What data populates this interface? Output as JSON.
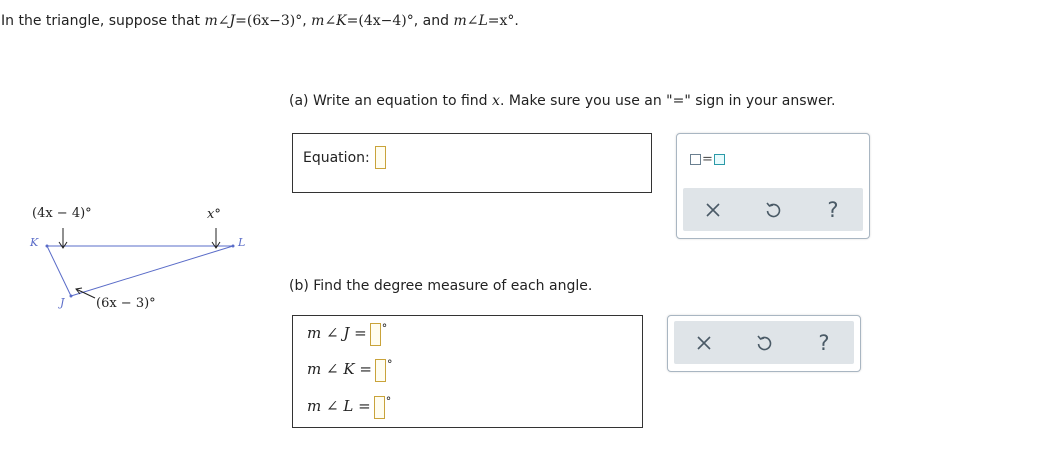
{
  "problem": {
    "intro": "In the triangle, suppose that ",
    "m": "m",
    "angle_symbol": "∠",
    "J": "J",
    "J_expr": "=(6x−3)°",
    "comma1": ", ",
    "K": "K",
    "K_expr": "=(4x−4)°",
    "comma2": ", and ",
    "L": "L",
    "L_expr": "=x°",
    "period": "."
  },
  "part_a": {
    "prefix": "(a)  Write an equation to find ",
    "var": "x",
    "suffix": ". Make sure you use an \"=\" sign in your answer.",
    "equation_label": "Equation:"
  },
  "part_b": {
    "prompt": "(b)  Find the degree measure of each angle.",
    "rows": [
      {
        "m": "m",
        "angle": "∠",
        "vertex": "J",
        "eq": "=",
        "deg": "°"
      },
      {
        "m": "m",
        "angle": "∠",
        "vertex": "K",
        "eq": "=",
        "deg": "°"
      },
      {
        "m": "m",
        "angle": "∠",
        "vertex": "L",
        "eq": "=",
        "deg": "°"
      }
    ]
  },
  "figure": {
    "label_K_angle": "(4x − 4)°",
    "label_L_angle": "x°",
    "label_J_angle": "(6x − 3)°",
    "vertex_K": "K",
    "vertex_L": "L",
    "vertex_J": "J",
    "line_color": "#5a6cc8"
  },
  "tools": {
    "template_icon": "equation-template-icon",
    "clear_icon": "close-icon",
    "undo_icon": "undo-icon",
    "help_label": "?"
  },
  "colors": {
    "answer_slot_border": "#c9a33a",
    "tool_bar": "#dfe4e8",
    "tool_icon": "#4a5a66"
  }
}
